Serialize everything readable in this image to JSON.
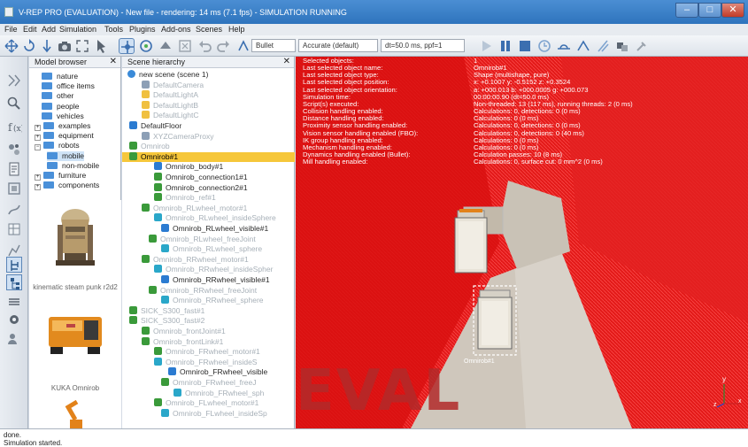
{
  "window": {
    "title": "V-REP PRO (EVALUATION) - New file - rendering: 14 ms (7.1 fps) - SIMULATION RUNNING",
    "minimize": "–",
    "maximize": "□",
    "close": "✕"
  },
  "menu": [
    "File",
    "Edit",
    "Add",
    "Simulation",
    "Tools",
    "Plugins",
    "Add-ons",
    "Scenes",
    "Help"
  ],
  "toolbar": {
    "engine": "Bullet",
    "accuracy": "Accurate (default)",
    "timestep": "dt=50.0 ms, ppf=1"
  },
  "model_browser": {
    "title": "Model browser",
    "close": "✕",
    "items": [
      {
        "label": "nature",
        "expander": ""
      },
      {
        "label": "office items",
        "expander": ""
      },
      {
        "label": "other",
        "expander": ""
      },
      {
        "label": "people",
        "expander": ""
      },
      {
        "label": "vehicles",
        "expander": ""
      },
      {
        "label": "examples",
        "expander": "+"
      },
      {
        "label": "equipment",
        "expander": "+"
      },
      {
        "label": "robots",
        "expander": "−"
      },
      {
        "label": "mobile",
        "expander": ""
      },
      {
        "label": "non-mobile",
        "expander": ""
      },
      {
        "label": "furniture",
        "expander": "+"
      },
      {
        "label": "components",
        "expander": "+"
      }
    ],
    "thumbnails": [
      "kinematic steam punk r2d2",
      "KUKA Omnirob"
    ]
  },
  "scene_hierarchy": {
    "title": "Scene hierarchy",
    "close": "✕",
    "rows": [
      {
        "label": "new scene (scene 1)",
        "style": "normal"
      },
      {
        "label": "DefaultCamera",
        "style": "grey"
      },
      {
        "label": "DefaultLightA",
        "style": "grey"
      },
      {
        "label": "DefaultLightB",
        "style": "grey"
      },
      {
        "label": "DefaultLightC",
        "style": "grey"
      },
      {
        "label": "DefaultFloor",
        "style": "normal"
      },
      {
        "label": "XYZCameraProxy",
        "style": "grey"
      },
      {
        "label": "Omnirob",
        "style": "grey"
      },
      {
        "label": "Omnirob#1",
        "style": "selected"
      },
      {
        "label": "Omnirob_body#1",
        "style": "normal"
      },
      {
        "label": "Omnirob_connection1#1",
        "style": "normal"
      },
      {
        "label": "Omnirob_connection2#1",
        "style": "normal"
      },
      {
        "label": "Omnirob_ref#1",
        "style": "grey"
      },
      {
        "label": "Omnirob_RLwheel_motor#1",
        "style": "grey"
      },
      {
        "label": "Omnirob_RLwheel_insideSphere",
        "style": "grey"
      },
      {
        "label": "Omnirob_RLwheel_visible#1",
        "style": "normal"
      },
      {
        "label": "Omnirob_RLwheel_freeJoint",
        "style": "grey"
      },
      {
        "label": "Omnirob_RLwheel_sphere",
        "style": "grey"
      },
      {
        "label": "Omnirob_RRwheel_motor#1",
        "style": "grey"
      },
      {
        "label": "Omnirob_RRwheel_insideSpher",
        "style": "grey"
      },
      {
        "label": "Omnirob_RRwheel_visible#1",
        "style": "normal"
      },
      {
        "label": "Omnirob_RRwheel_freeJoint",
        "style": "grey"
      },
      {
        "label": "Omnirob_RRwheel_sphere",
        "style": "grey"
      },
      {
        "label": "SICK_S300_fast#1",
        "style": "grey"
      },
      {
        "label": "SICK_S300_fast#2",
        "style": "grey"
      },
      {
        "label": "Omnirob_frontJoint#1",
        "style": "grey"
      },
      {
        "label": "Omnirob_frontLink#1",
        "style": "grey"
      },
      {
        "label": "Omnirob_FRwheel_motor#1",
        "style": "grey"
      },
      {
        "label": "Omnirob_FRwheel_insideS",
        "style": "grey"
      },
      {
        "label": "Omnirob_FRwheel_visible",
        "style": "normal"
      },
      {
        "label": "Omnirob_FRwheel_freeJ",
        "style": "grey"
      },
      {
        "label": "Omnirob_FRwheel_sph",
        "style": "grey"
      },
      {
        "label": "Omnirob_FLwheel_motor#1",
        "style": "grey"
      },
      {
        "label": "Omnirob_FLwheel_insideSp",
        "style": "grey"
      }
    ]
  },
  "viewport": {
    "info_left": [
      "Selected objects:",
      "Last selected object name:",
      "Last selected object type:",
      "Last selected object position:",
      "Last selected object orientation:",
      "Simulation time:",
      "Script(s) executed:",
      "Collision handling enabled:",
      "Distance handling enabled:",
      "Proximity sensor handling enabled:",
      "Vision sensor handling enabled (FBO):",
      "IK group handling enabled:",
      "Mechanism handling enabled:",
      "Dynamics handling enabled (Bullet):",
      "Mill handling enabled:"
    ],
    "info_right": [
      "1",
      "Omnirob#1",
      "Shape (multishape, pure)",
      "x: +0.1007   y: -0.5152   z: +0.3524",
      "a: +000.013   b: +000.0005   g: +000.073",
      "00:00:00.90 (dt=50.0 ms)",
      "Non-threaded: 13 (117 ms), running threads: 2 (0 ms)",
      "Calculations: 0, detections: 0 (0 ms)",
      "Calculations: 0 (0 ms)",
      "Calculations: 0, detections: 0 (0 ms)",
      "Calculations: 0, detections: 0 (40 ms)",
      "Calculations: 0 (0 ms)",
      "Calculations: 0 (0 ms)",
      "Calculation passes: 10 (8 ms)",
      "Calculations: 0, surface cut: 0 mm^2 (0 ms)"
    ],
    "object_label": "Omnirob#1",
    "watermark": "EVAL",
    "axis_y": "y",
    "axis_x": "x",
    "axis_z": "z"
  },
  "status": {
    "line1": "done.",
    "line2": "Simulation started."
  },
  "colors": {
    "accent": "#f6c73a",
    "laser": "#e00000",
    "folder": "#4a90d9"
  }
}
